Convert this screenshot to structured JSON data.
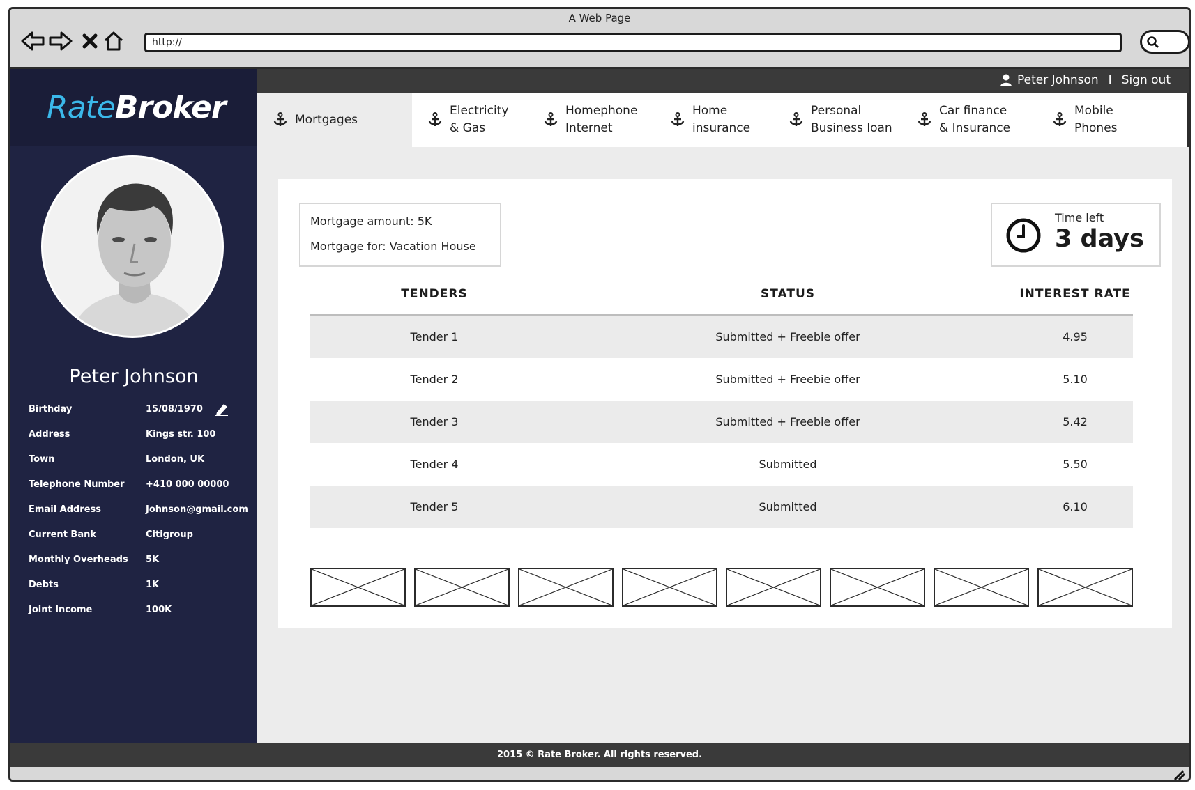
{
  "window": {
    "title": "A Web Page"
  },
  "browser": {
    "url": "http://"
  },
  "topbar": {
    "user_name": "Peter Johnson",
    "separator": "I",
    "sign_out": "Sign out"
  },
  "sidebar": {
    "logo": {
      "part1": "Rate",
      "part2": "Broker"
    },
    "profile": {
      "name": "Peter Johnson",
      "fields": [
        {
          "label": "Birthday",
          "value": "15/08/1970"
        },
        {
          "label": "Address",
          "value": "Kings str. 100"
        },
        {
          "label": "Town",
          "value": "London, UK"
        },
        {
          "label": "Telephone Number",
          "value": "+410 000 00000"
        },
        {
          "label": "Email Address",
          "value": "Johnson@gmail.com"
        },
        {
          "label": "Current Bank",
          "value": "Citigroup"
        },
        {
          "label": "Monthly Overheads",
          "value": "5K"
        },
        {
          "label": "Debts",
          "value": "1K"
        },
        {
          "label": "Joint Income",
          "value": "100K"
        }
      ]
    }
  },
  "tabs": [
    {
      "line1": "Mortgages",
      "line2": ""
    },
    {
      "line1": "Electricity",
      "line2": "& Gas"
    },
    {
      "line1": "Homephone",
      "line2": "Internet"
    },
    {
      "line1": "Home",
      "line2": "insurance"
    },
    {
      "line1": "Personal",
      "line2": "Business loan"
    },
    {
      "line1": "Car finance",
      "line2": "& Insurance"
    },
    {
      "line1": "Mobile",
      "line2": "Phones"
    }
  ],
  "mortgage": {
    "amount": "Mortgage amount: 5K",
    "purpose": "Mortgage for: Vacation House"
  },
  "timer": {
    "label": "Time left",
    "value": "3 days"
  },
  "table": {
    "headers": [
      "TENDERS",
      "STATUS",
      "INTEREST RATE"
    ],
    "rows": [
      {
        "tender": "Tender 1",
        "status": "Submitted + Freebie offer",
        "rate": "4.95"
      },
      {
        "tender": "Tender 2",
        "status": "Submitted + Freebie offer",
        "rate": "5.10"
      },
      {
        "tender": "Tender 3",
        "status": "Submitted + Freebie offer",
        "rate": "5.42"
      },
      {
        "tender": "Tender 4",
        "status": "Submitted",
        "rate": "5.50"
      },
      {
        "tender": "Tender 5",
        "status": "Submitted",
        "rate": "6.10"
      }
    ]
  },
  "footer": {
    "text": "2015 © Rate Broker. All rights reserved."
  },
  "colors": {
    "sidebar": "#1f2342",
    "logo_accent": "#3bb8ea",
    "bars": "#3a3a3a",
    "content_bg": "#ececec"
  },
  "icons": [
    "back-arrow-icon",
    "forward-arrow-icon",
    "close-icon",
    "home-icon",
    "search-icon",
    "user-icon",
    "edit-icon",
    "anchor-icon",
    "clock-icon",
    "image-placeholder-icon",
    "resize-grip-icon"
  ]
}
